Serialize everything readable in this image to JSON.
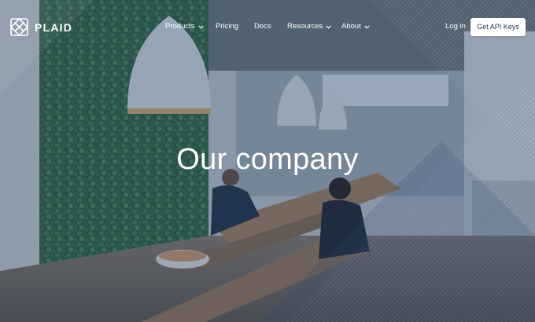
{
  "nav": {
    "logo_text": "PLAID",
    "items": [
      {
        "label": "Products",
        "has_dropdown": true
      },
      {
        "label": "Pricing",
        "has_dropdown": false
      },
      {
        "label": "Docs",
        "has_dropdown": false
      },
      {
        "label": "Resources",
        "has_dropdown": true
      },
      {
        "label": "About",
        "has_dropdown": true
      }
    ],
    "login_label": "Log in",
    "cta_label": "Get API Keys"
  },
  "hero": {
    "title": "Our company",
    "background": "office photo: green living wall, pendant lamps, wooden communal table with two people",
    "overlay_color": "#264268"
  },
  "icons": {
    "logo": "plaid-logo-icon",
    "dropdown": "chevron-down-icon"
  }
}
